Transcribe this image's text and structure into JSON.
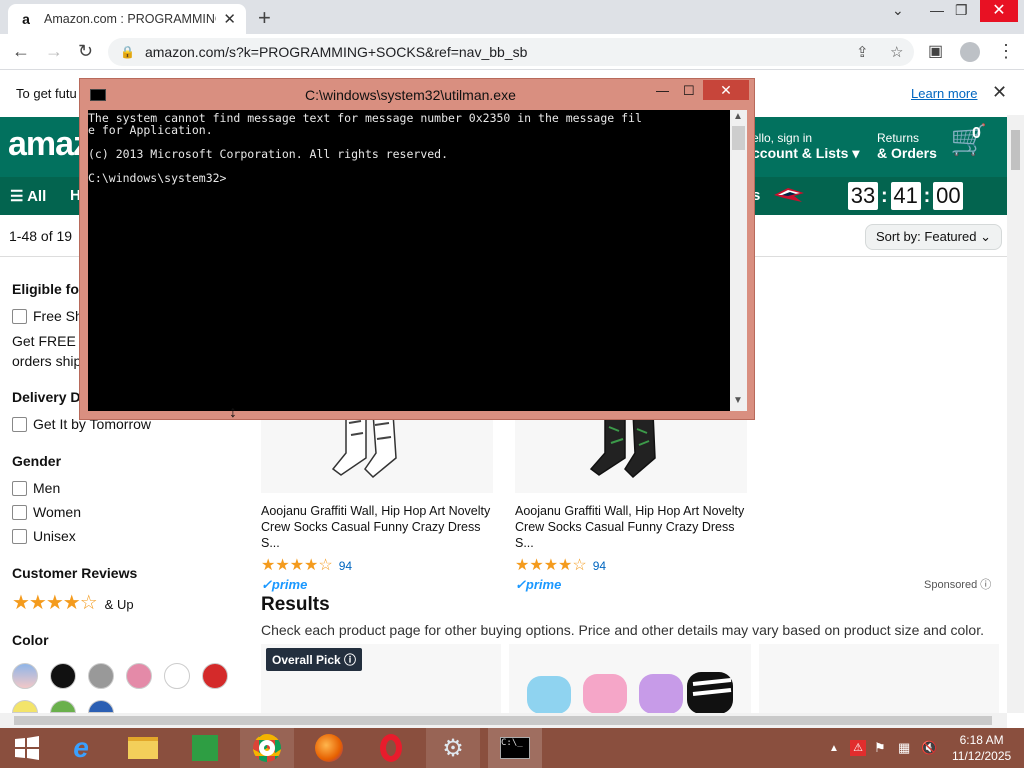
{
  "browser": {
    "tab_title": "Amazon.com : PROGRAMMING S",
    "tab_favicon": "a",
    "url": "amazon.com/s?k=PROGRAMMING+SOCKS&ref=nav_bb_sb"
  },
  "notice": {
    "text": "To get futu",
    "learn_more": "Learn more"
  },
  "header": {
    "logo": "amaz",
    "account_line1": "ello, sign in",
    "account_line2": "ccount & Lists",
    "returns_line1": "Returns",
    "returns_line2": "& Orders",
    "cart_count": "0"
  },
  "nav": {
    "all": "All",
    "partial_h": "H",
    "partial_s": "s",
    "countdown": [
      "33",
      "41",
      "00"
    ]
  },
  "results_bar": {
    "count": "1-48 of 19",
    "sort_label": "Sort by:",
    "sort_value": "Featured"
  },
  "sidebar": {
    "eligible_heading": "Eligible fo",
    "free_shipping": "Free Sh",
    "free_note1": "Get FREE S",
    "free_note2": "orders ship",
    "delivery_heading": "Delivery D",
    "get_it_tomorrow": "Get It by Tomorrow",
    "gender_heading": "Gender",
    "men": "Men",
    "women": "Women",
    "unisex": "Unisex",
    "reviews_heading": "Customer Reviews",
    "and_up": "& Up",
    "color_heading": "Color"
  },
  "products": [
    {
      "title_line1": "Aoojanu Graffiti Wall, Hip Hop Art Novelty",
      "title_line2": "Crew Socks Casual Funny Crazy Dress S...",
      "rating_count": "94",
      "prime": "prime"
    },
    {
      "title_line1": "Aoojanu Graffiti Wall, Hip Hop Art Novelty",
      "title_line2": "Crew Socks Casual Funny Crazy Dress S...",
      "rating_count": "94",
      "prime": "prime"
    }
  ],
  "results": {
    "sponsored": "Sponsored",
    "heading": "Results",
    "subtitle": "Check each product page for other buying options. Price and other details may vary based on product size and color.",
    "overall_pick": "Overall Pick"
  },
  "cmd": {
    "title": "C:\\windows\\system32\\utilman.exe",
    "line1": "The system cannot find message text for message number 0x2350 in the message fil",
    "line2": "e for Application.",
    "line3": "(c) 2013 Microsoft Corporation. All rights reserved.",
    "line4": "C:\\windows\\system32>"
  },
  "taskbar": {
    "time": "6:18 AM",
    "date": "11/12/2025"
  },
  "colors": {
    "amazon_header": "#02715e",
    "amazon_nav": "#03644f",
    "cmd_frame": "#d98f80",
    "taskbar": "#8a4f3e",
    "star": "#f49b1d"
  }
}
